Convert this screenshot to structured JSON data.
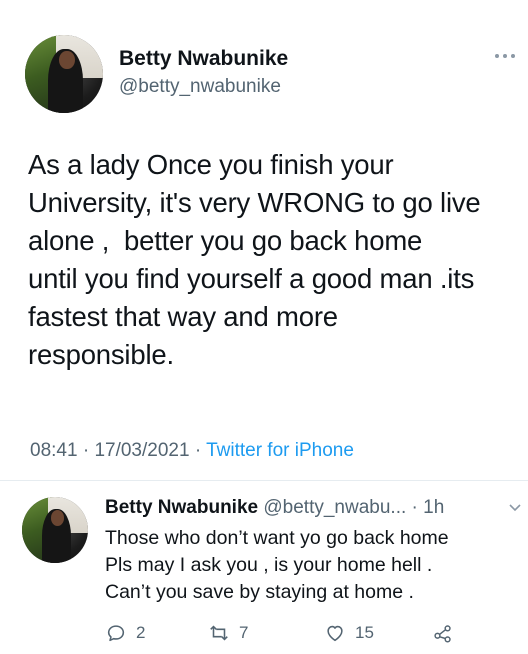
{
  "tweet": {
    "author_name": "Betty Nwabunike",
    "author_handle": "@betty_nwabunike",
    "text_lines": [
      "As a lady Once you finish your",
      "University, it's very WRONG to go live",
      "alone ,  better you go back home",
      "until you find yourself a good man .its",
      "fastest that way and more",
      "responsible."
    ],
    "time": "08:41",
    "date": "17/03/2021",
    "source": "Twitter for iPhone",
    "more_icon": "more-horizontal-icon"
  },
  "reply": {
    "author_name": "Betty Nwabunike",
    "author_handle": "@betty_nwabu...",
    "age": "1h",
    "text_lines": [
      "Those who  don’t want yo go back home",
      "Pls may I ask you , is your home hell .",
      "Can’t you save  by staying at home ."
    ],
    "reply_count": "2",
    "retweet_count": "7",
    "like_count": "15",
    "icons": [
      "comment-icon",
      "retweet-icon",
      "like-icon",
      "share-icon",
      "chevron-down-icon"
    ]
  },
  "colors": {
    "text": "#0f1419",
    "muted": "#536471",
    "link": "#1d9bf0",
    "divider": "#e6ecf0"
  }
}
